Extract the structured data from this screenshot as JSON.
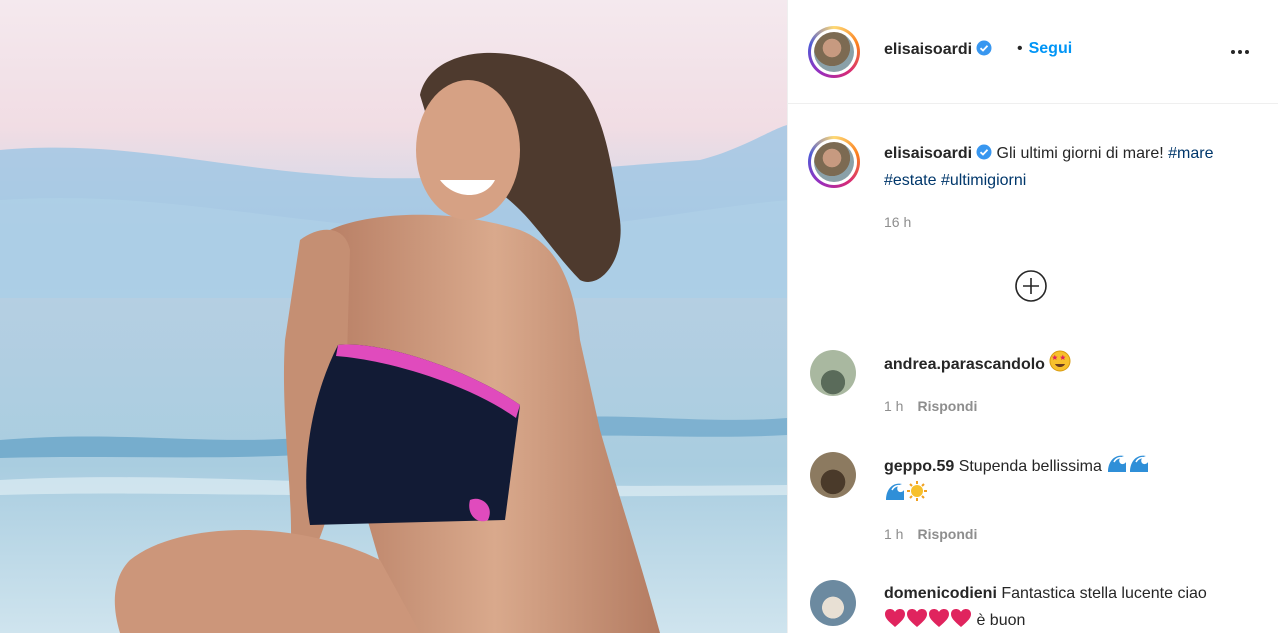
{
  "post": {
    "author": "elisaisoardi",
    "follow_dot": "•",
    "follow_label": "Segui",
    "caption_user": "elisaisoardi",
    "caption_text": "Gli ultimi giorni di mare!",
    "hashtags": [
      "#mare",
      "#estate",
      "#ultimigiorni"
    ],
    "time": "16 h"
  },
  "comments": [
    {
      "user": "andrea.parascandolo",
      "text": "",
      "emojis": [
        "star-eyes"
      ],
      "time": "1 h",
      "reply": "Rispondi"
    },
    {
      "user": "geppo.59",
      "text": "Stupenda bellissima",
      "emojis": [
        "wave",
        "wave",
        "wave",
        "sun"
      ],
      "time": "1 h",
      "reply": "Rispondi"
    },
    {
      "user": "domenicodieni",
      "text": "Fantastica stella lucente ciao",
      "text_after": "è buon",
      "emojis": [
        "heart",
        "heart",
        "heart",
        "heart"
      ]
    }
  ],
  "colors": {
    "link": "#0095f6",
    "hashtag": "#00376b",
    "muted": "#8e8e8e",
    "verified": "#3897f0",
    "heart": "#e0245e"
  },
  "icons": [
    "verified-badge-icon",
    "more-options-icon",
    "load-more-plus-icon"
  ]
}
